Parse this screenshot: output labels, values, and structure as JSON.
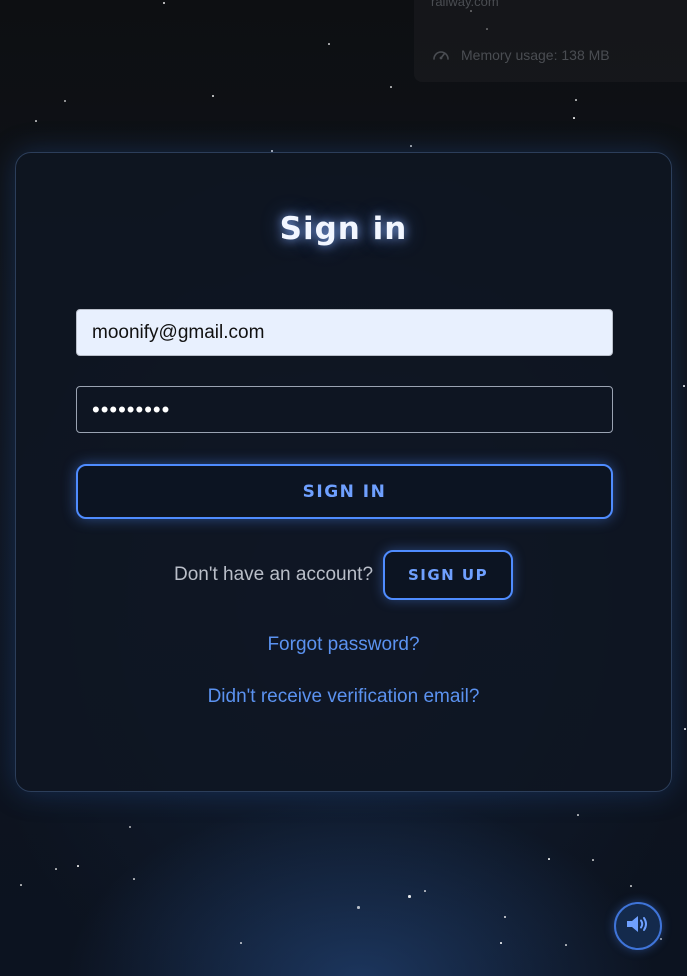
{
  "top_panel": {
    "domain_text": "railway.com",
    "memory_label": "Memory usage: 138 MB",
    "memory_icon": "gauge-icon"
  },
  "form": {
    "title": "Sign in",
    "email_value": "moonify@gmail.com",
    "password_value": "•••••••••",
    "submit_label": "SIGN IN"
  },
  "signup": {
    "prompt": "Don't have an account?",
    "button_label": "SIGN UP"
  },
  "links": {
    "forgot_password": "Forgot password?",
    "resend_verification": "Didn't receive verification email?"
  },
  "sound_toggle": {
    "icon": "speaker-volume-icon"
  },
  "colors": {
    "accent": "#4f8cff",
    "link": "#5b92f0",
    "card_border": "#2c3e5a"
  }
}
